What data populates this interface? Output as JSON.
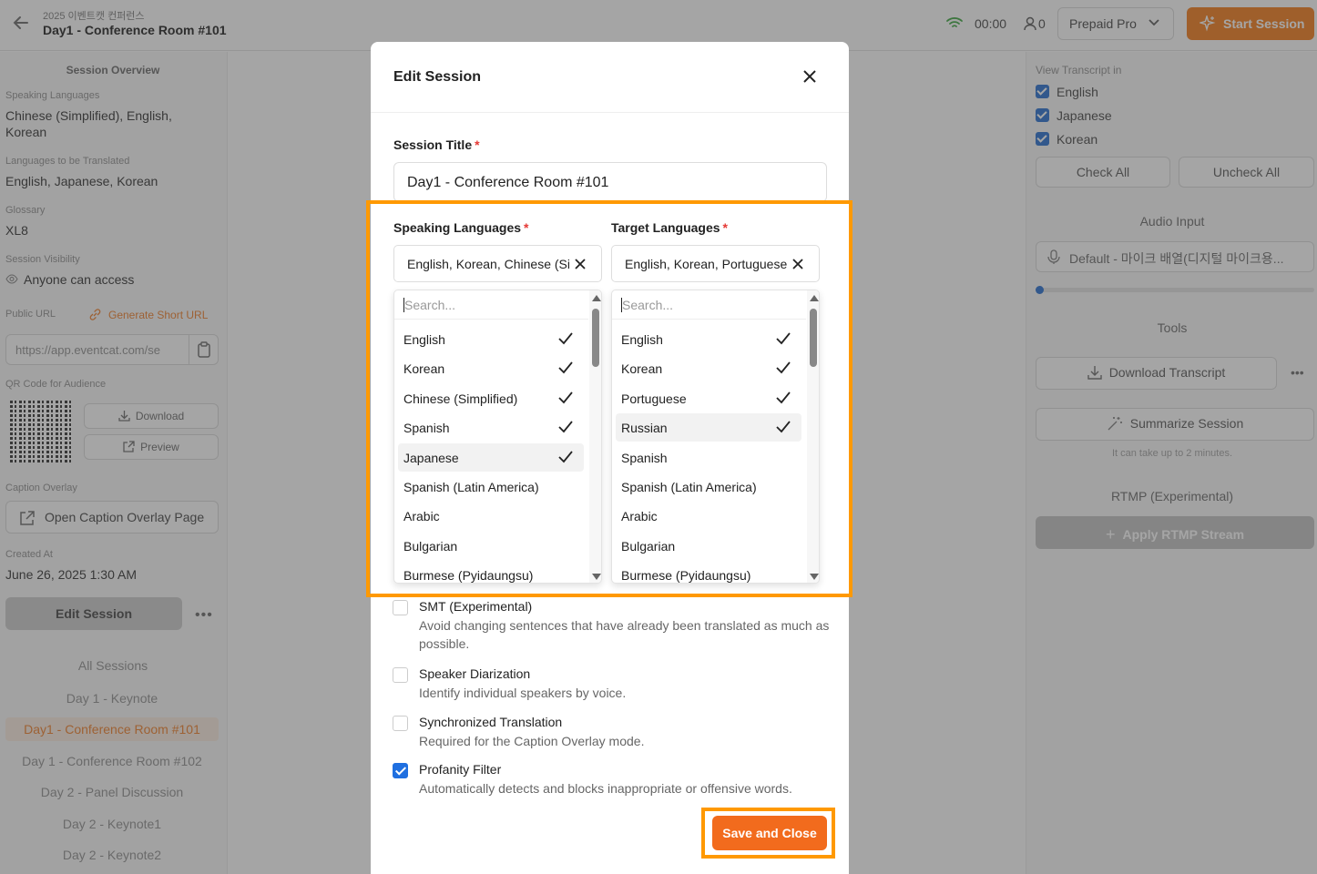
{
  "header": {
    "event_name": "2025 이벤트캣 컨퍼런스",
    "session_title": "Day1 - Conference Room #101",
    "timer": "00:00",
    "audience_count": "0",
    "plan": "Prepaid Pro",
    "start_button": "Start Session"
  },
  "left": {
    "overview_title": "Session Overview",
    "speaking_label": "Speaking Languages",
    "speaking_value": "Chinese (Simplified), English, Korean",
    "translated_label": "Languages to be Translated",
    "translated_value": "English, Japanese, Korean",
    "glossary_label": "Glossary",
    "glossary_value": "XL8",
    "visibility_label": "Session Visibility",
    "visibility_value": "Anyone can access",
    "public_url_label": "Public URL",
    "generate_short_url": "Generate Short URL",
    "public_url_value": "https://app.eventcat.com/se",
    "qr_label": "QR Code for Audience",
    "download": "Download",
    "preview": "Preview",
    "caption_label": "Caption Overlay",
    "caption_button": "Open Caption Overlay Page",
    "created_label": "Created At",
    "created_value": "June 26, 2025 1:30 AM",
    "edit_button": "Edit Session",
    "all_sessions": "All Sessions",
    "sessions": [
      "Day 1 - Keynote",
      "Day1 - Conference Room #101",
      "Day 1 - Conference Room #102",
      "Day 2 - Panel Discussion",
      "Day 2 - Keynote1",
      "Day 2 - Keynote2"
    ],
    "active_session_index": 1
  },
  "right": {
    "view_transcript_label": "View Transcript in",
    "transcript_languages": [
      "English",
      "Japanese",
      "Korean"
    ],
    "check_all": "Check All",
    "uncheck_all": "Uncheck All",
    "audio_input_title": "Audio Input",
    "audio_device": "Default - 마이크 배열(디지털 마이크용...",
    "tools_title": "Tools",
    "download_transcript": "Download Transcript",
    "summarize": "Summarize Session",
    "summarize_hint": "It can take up to 2 minutes.",
    "rtmp_title": "RTMP (Experimental)",
    "rtmp_button": "Apply RTMP Stream"
  },
  "modal": {
    "title": "Edit Session",
    "session_title_label": "Session Title",
    "session_title_value": "Day1 - Conference Room #101",
    "speaking_label": "Speaking Languages",
    "speaking_selected": "English, Korean, Chinese (Simplified), Spanish, Japanese",
    "target_label": "Target Languages",
    "target_selected": "English, Korean, Portuguese, Russian",
    "search_placeholder": "Search...",
    "speaking_options": [
      {
        "label": "English",
        "checked": true
      },
      {
        "label": "Korean",
        "checked": true
      },
      {
        "label": "Chinese (Simplified)",
        "checked": true
      },
      {
        "label": "Spanish",
        "checked": true
      },
      {
        "label": "Japanese",
        "checked": true
      },
      {
        "label": "Spanish (Latin America)",
        "checked": false
      },
      {
        "label": "Arabic",
        "checked": false
      },
      {
        "label": "Bulgarian",
        "checked": false
      },
      {
        "label": "Burmese (Pyidaungsu)",
        "checked": false
      }
    ],
    "speaking_highlight_index": 4,
    "target_options": [
      {
        "label": "English",
        "checked": true
      },
      {
        "label": "Korean",
        "checked": true
      },
      {
        "label": "Portuguese",
        "checked": true
      },
      {
        "label": "Russian",
        "checked": true
      },
      {
        "label": "Spanish",
        "checked": false
      },
      {
        "label": "Spanish (Latin America)",
        "checked": false
      },
      {
        "label": "Arabic",
        "checked": false
      },
      {
        "label": "Bulgarian",
        "checked": false
      },
      {
        "label": "Burmese (Pyidaungsu)",
        "checked": false
      }
    ],
    "target_highlight_index": 3,
    "options": [
      {
        "title": "SMT (Experimental)",
        "desc": "Avoid changing sentences that have already been translated as much as possible.",
        "checked": false
      },
      {
        "title": "Speaker Diarization",
        "desc": "Identify individual speakers by voice.",
        "checked": false
      },
      {
        "title": "Synchronized Translation",
        "desc": "Required for the Caption Overlay mode.",
        "checked": false
      },
      {
        "title": "Profanity Filter",
        "desc": "Automatically detects and blocks inappropriate or offensive words.",
        "checked": true
      }
    ],
    "save_button": "Save and Close"
  },
  "colors": {
    "accent": "#f26b1d",
    "highlight": "#ff9900",
    "check": "#1f6fe0"
  }
}
